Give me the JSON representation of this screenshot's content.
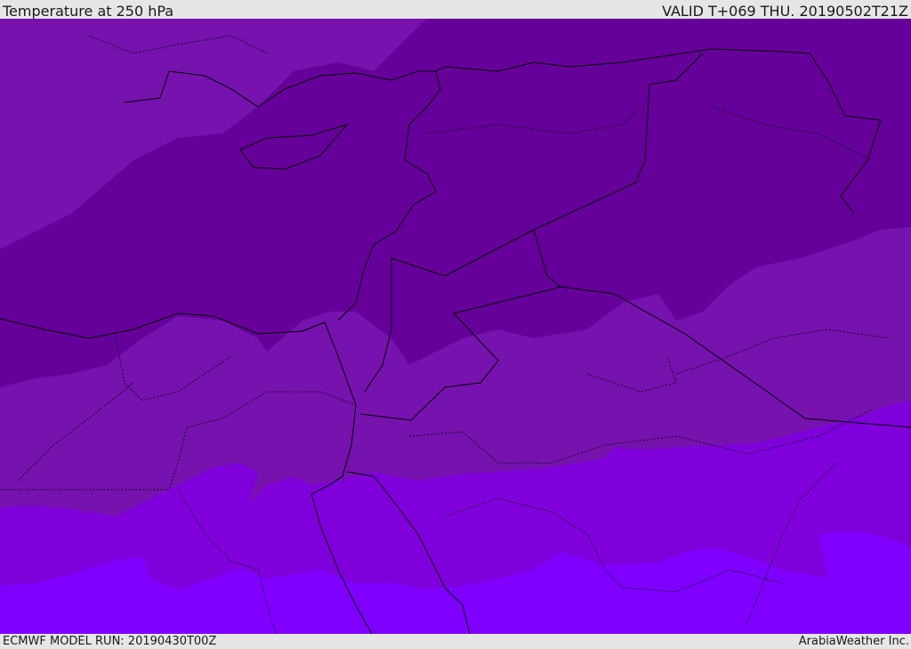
{
  "header": {
    "title": "Temperature at 250 hPa",
    "valid": "VALID T+069 THU. 20190502T21Z"
  },
  "footer": {
    "model_run": "ECMWF MODEL RUN: 20190430T00Z",
    "credit": "ArabiaWeather Inc."
  },
  "colors": {
    "darkest": "#66009a",
    "medium": "#7612ae",
    "violet": "#8000dc",
    "bright_violet": "#7f00ff",
    "borders": "#000000"
  }
}
